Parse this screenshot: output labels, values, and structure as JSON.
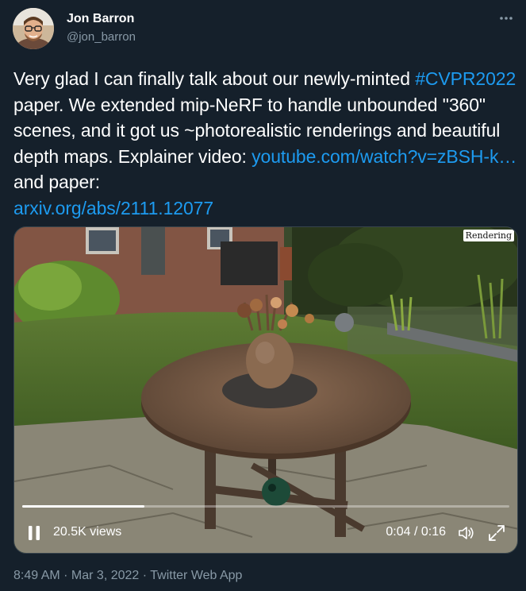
{
  "author": {
    "name": "Jon Barron",
    "handle": "@jon_barron"
  },
  "tweet": {
    "text_1": "Very glad I can finally talk about our newly-minted ",
    "hashtag": "#CVPR2022",
    "text_2": " paper. We extended mip-NeRF to handle unbounded \"360\" scenes, and it got us ~photorealistic renderings and beautiful depth maps. Explainer video: ",
    "link_video": "youtube.com/watch?v=zBSH-k…",
    "text_3": " and paper: ",
    "link_paper": "arxiv.org/abs/2111.12077"
  },
  "media": {
    "badge": "Rendering",
    "views": "20.5K views",
    "time": "0:04 / 0:16",
    "progress": 0.25,
    "icons": {
      "play_state": "pause-icon",
      "volume": "volume-icon",
      "fullscreen": "fullscreen-icon"
    }
  },
  "meta": {
    "time": "8:49 AM",
    "sep1": " · ",
    "date": "Mar 3, 2022",
    "sep2": " · ",
    "source": "Twitter Web App"
  },
  "colors": {
    "background": "#15202b",
    "link": "#1d9bf0",
    "secondary_text": "#8899a6"
  }
}
